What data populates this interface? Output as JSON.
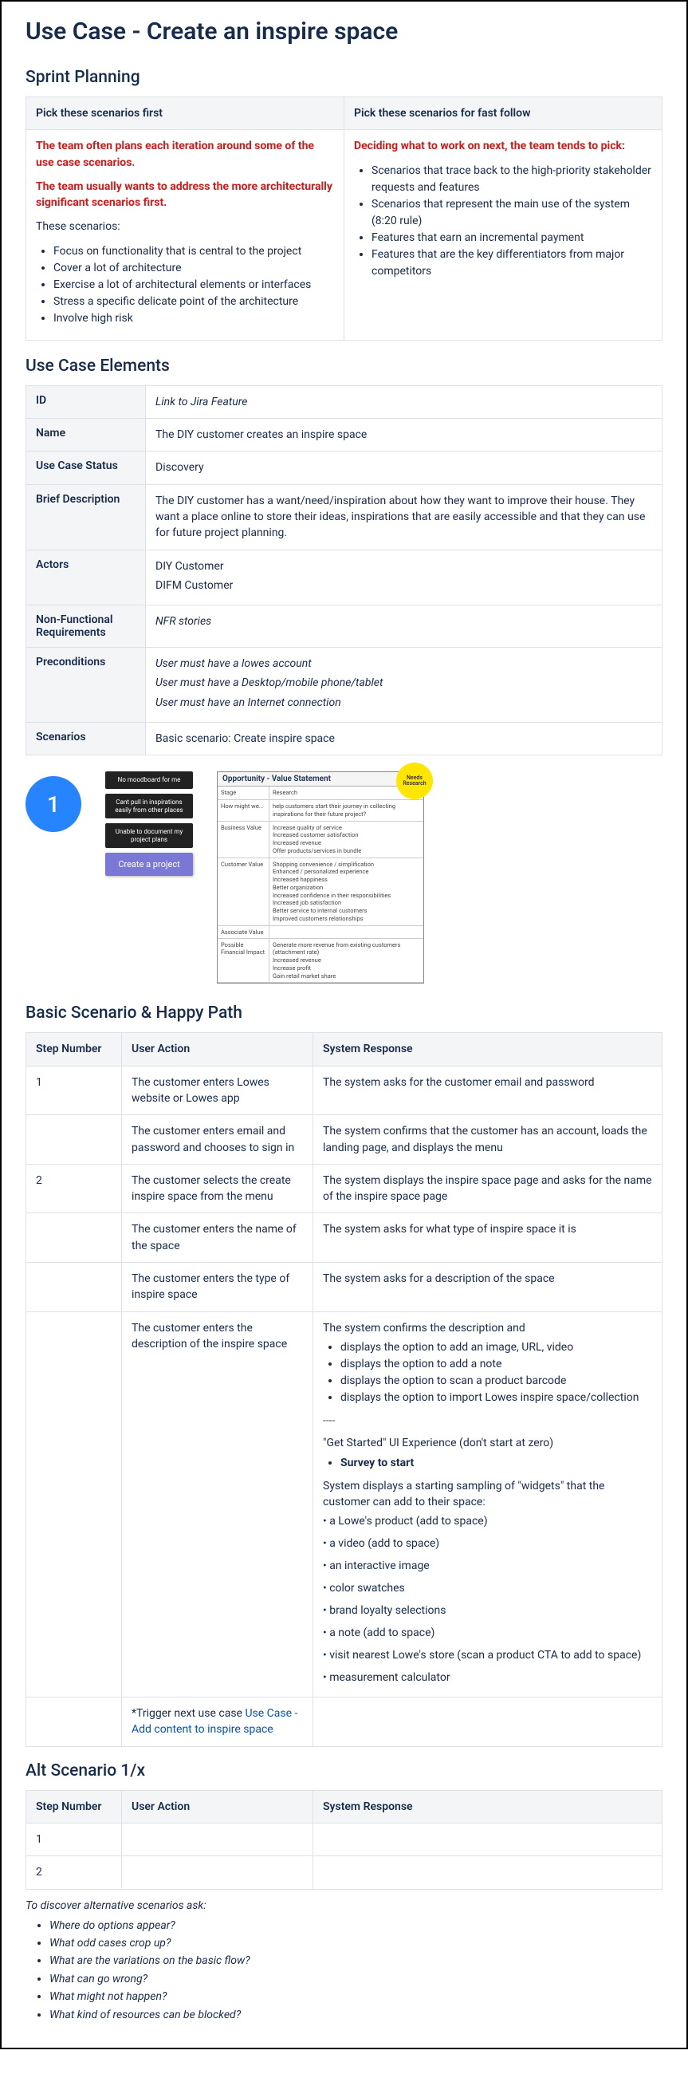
{
  "title": "Use Case - Create an inspire space",
  "sections": {
    "sprint": "Sprint Planning",
    "ucelements": "Use Case Elements",
    "basic": "Basic Scenario & Happy Path",
    "alt": "Alt Scenario 1/x"
  },
  "sprint": {
    "col1_header": "Pick these scenarios first",
    "col2_header": "Pick these scenarios for fast follow",
    "col1_red1": "The team often plans each iteration around some of the use case scenarios.",
    "col1_red2": "The team usually wants to address the more architecturally significant scenarios first.",
    "col1_lead": "These scenarios:",
    "col1_items": [
      "Focus on functionality that is central to the project",
      "Cover a lot of architecture",
      "Exercise a lot of architectural elements or interfaces",
      "Stress a specific delicate point of the architecture",
      "Involve high risk"
    ],
    "col2_red": "Deciding what to work on next, the team tends to pick:",
    "col2_items": [
      "Scenarios that trace back to the high-priority stakeholder requests and features",
      "Scenarios that represent the main use of the system (8:20 rule)",
      "Features that earn an incremental payment",
      "Features that are the key differentiators from major competitors"
    ]
  },
  "uc": {
    "rows": {
      "id_label": "ID",
      "id_val": "Link to Jira Feature",
      "name_label": "Name",
      "name_val": "The DIY customer creates an inspire space",
      "status_label": "Use Case Status",
      "status_val": "Discovery",
      "brief_label": "Brief Description",
      "brief_val": "The DIY customer has a want/need/inspiration about how they want to improve their house. They want a place online to store their ideas, inspirations that are easily accessible and that they can use for future project planning.",
      "actors_label": "Actors",
      "actors_val1": "DIY Customer",
      "actors_val2": "DIFM Customer",
      "nfr_label": "Non-Functional Requirements",
      "nfr_val": "NFR stories",
      "pre_label": "Preconditions",
      "pre_val1": "User must have a lowes account",
      "pre_val2": "User must have a Desktop/mobile phone/tablet",
      "pre_val3": "User must have an Internet connection",
      "scen_label": "Scenarios",
      "scen_val": "Basic scenario: Create inspire space"
    }
  },
  "diagram": {
    "circle": "1",
    "cards": [
      "No moodboard for me",
      "Cant pull in inspirations easily from other places",
      "Unable to document my project plans"
    ],
    "create_card": "Create a project",
    "opp_title": "Opportunity - Value Statement",
    "opp_stage": "Stage",
    "opp_research": "Research",
    "opp_badge": "Needs Research",
    "row_how": "How might we...",
    "row_how_val": "help customers start their journey in collecting inspirations for their future project?",
    "row_biz": "Business Value",
    "row_biz_vals": "Increase quality of service\nIncreased customer satisfaction\nIncreased revenue\nOffer products/services in bundle",
    "row_cust": "Customer Value",
    "row_cust_vals": "Shopping convenience / simplification\nEnhanced / personalized experience\nIncreased happiness\nBetter organization\nIncreased confidence in their responsibilities\nIncreased job satisfaction\nBetter service to internal customers\nImproved customers relationships",
    "row_assoc": "Associate Value",
    "row_fin": "Possible Financial Impact",
    "row_fin_vals": "Generate more revenue from existing customers (attachment rate)\nIncreased revenue\nIncrease profit\nGain retail market share"
  },
  "scenario": {
    "h_step": "Step Number",
    "h_act": "User Action",
    "h_resp": "System Response",
    "rows": [
      {
        "step": "1",
        "act": "The customer enters Lowes website or Lowes app",
        "resp": "The system asks for the customer email and password"
      },
      {
        "step": "",
        "act": "The customer enters email and password and chooses to sign in",
        "resp": "The system confirms that the customer has an account, loads the landing page, and displays the menu"
      },
      {
        "step": "2",
        "act": "The customer selects the create inspire space from the menu",
        "resp": "The system displays the inspire space page and asks for the name of the inspire space page"
      },
      {
        "step": "",
        "act": "The customer enters the name of the space",
        "resp": "The system asks for what type of inspire space it is"
      },
      {
        "step": "",
        "act": "The customer enters the type of inspire space",
        "resp": "The system asks for a description of the space"
      }
    ],
    "big_act": "The customer enters the description of the inspire space",
    "big_resp_lead": "The system confirms the description and",
    "big_resp_items": [
      "displays the option to add an image, URL, video",
      "displays the option to add a note",
      "displays the option to scan a product barcode",
      "displays the option to import Lowes inspire space/collection"
    ],
    "sep": "----",
    "get_started": "\"Get Started\" UI Experience (don't start at zero)",
    "survey": "Survey to start",
    "widgets_lead": "System displays a starting sampling of \"widgets\" that the customer can add to their space:",
    "widgets": [
      "a Lowe's product (add to space)",
      "a video (add to space)",
      "an interactive image",
      "color swatches",
      "brand loyalty selections",
      "a note (add to space)",
      "visit nearest Lowe's store (scan a product CTA to add to space)",
      "measurement calculator"
    ],
    "trigger_pre": "*Trigger next use case ",
    "trigger_link": "Use Case - Add content to inspire space"
  },
  "alt": {
    "h_step": "Step Number",
    "h_act": "User Action",
    "h_resp": "System Response",
    "rows": [
      "1",
      "2"
    ],
    "note": "To discover alternative scenarios ask:",
    "items": [
      "Where do options appear?",
      "What odd cases crop up?",
      "What are the variations on the basic flow?",
      "What can go wrong?",
      "What might not happen?",
      "What kind of resources can be blocked?"
    ]
  }
}
